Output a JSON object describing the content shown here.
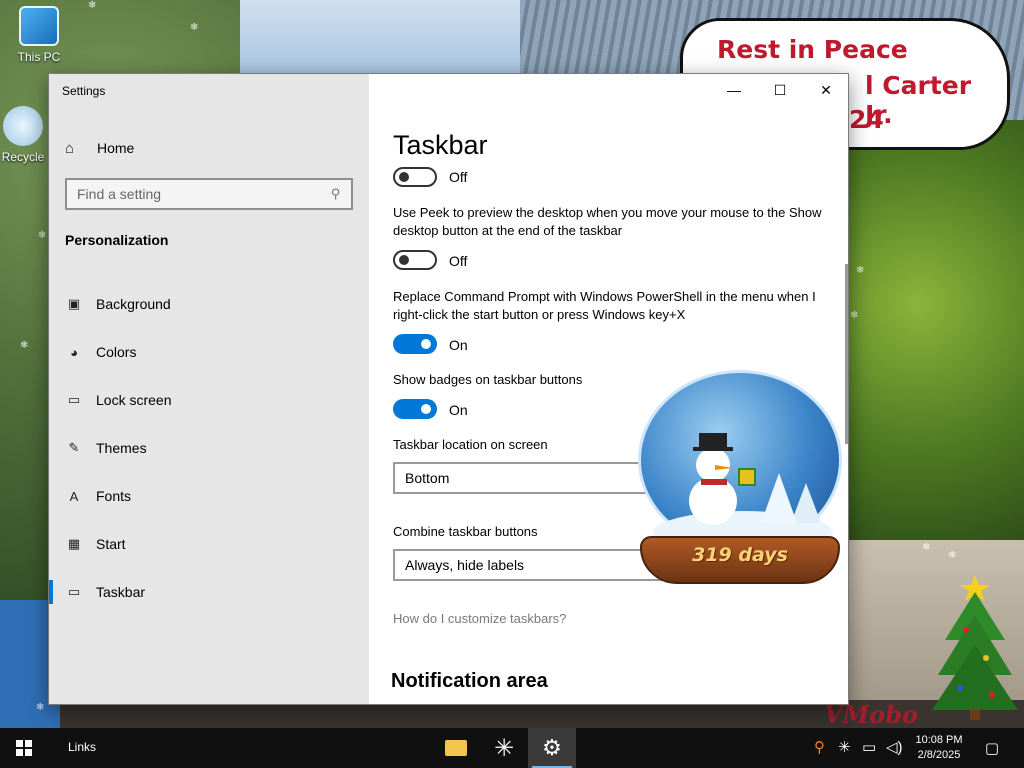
{
  "desktop": {
    "icons": [
      {
        "label": "This PC",
        "icon": "computer-icon"
      },
      {
        "label": "Recycle",
        "icon": "recycle-bin-icon"
      }
    ],
    "banner": {
      "line1": "Rest in Peace",
      "line2": "l Carter Jr.",
      "line3": "24"
    },
    "watermark": "VMobo",
    "snow_globe_text": "319 days"
  },
  "window": {
    "title": "Settings",
    "controls": {
      "minimize": "—",
      "maximize": "☐",
      "close": "✕"
    }
  },
  "sidebar": {
    "home_label": "Home",
    "search_placeholder": "Find a setting",
    "section_label": "Personalization",
    "items": [
      {
        "label": "Background",
        "icon": "image-icon",
        "active": false
      },
      {
        "label": "Colors",
        "icon": "palette-icon",
        "active": false
      },
      {
        "label": "Lock screen",
        "icon": "lock-screen-icon",
        "active": false
      },
      {
        "label": "Themes",
        "icon": "themes-icon",
        "active": false
      },
      {
        "label": "Fonts",
        "icon": "fonts-icon",
        "active": false
      },
      {
        "label": "Start",
        "icon": "start-icon",
        "active": false
      },
      {
        "label": "Taskbar",
        "icon": "taskbar-icon",
        "active": true
      }
    ]
  },
  "content": {
    "title": "Taskbar",
    "toggle_top": {
      "state": "Off"
    },
    "peek": {
      "description": "Use Peek to preview the desktop when you move your mouse to the Show desktop button at the end of the taskbar",
      "state": "Off"
    },
    "powershell": {
      "description": "Replace Command Prompt with Windows PowerShell in the menu when I right-click the start button or press Windows key+X",
      "state": "On"
    },
    "badges": {
      "description": "Show badges on taskbar buttons",
      "state": "On"
    },
    "location": {
      "label": "Taskbar location on screen",
      "value": "Bottom"
    },
    "combine": {
      "label": "Combine taskbar buttons",
      "value": "Always, hide labels"
    },
    "help_link": "How do I customize taskbars?",
    "notification_heading": "Notification area"
  },
  "taskbar": {
    "links_label": "Links",
    "apps": [
      {
        "name": "File Explorer",
        "icon": "folder-icon"
      },
      {
        "name": "Snowflake",
        "icon": "snowflake-icon"
      },
      {
        "name": "Settings",
        "icon": "gear-icon"
      }
    ],
    "clock": {
      "time": "10:08 PM",
      "date": "2/8/2025"
    }
  },
  "colors": {
    "accent": "#0078d7",
    "taskbar": "#101010",
    "sidebar": "#e6e6e6",
    "banner_text": "#c0182c"
  }
}
